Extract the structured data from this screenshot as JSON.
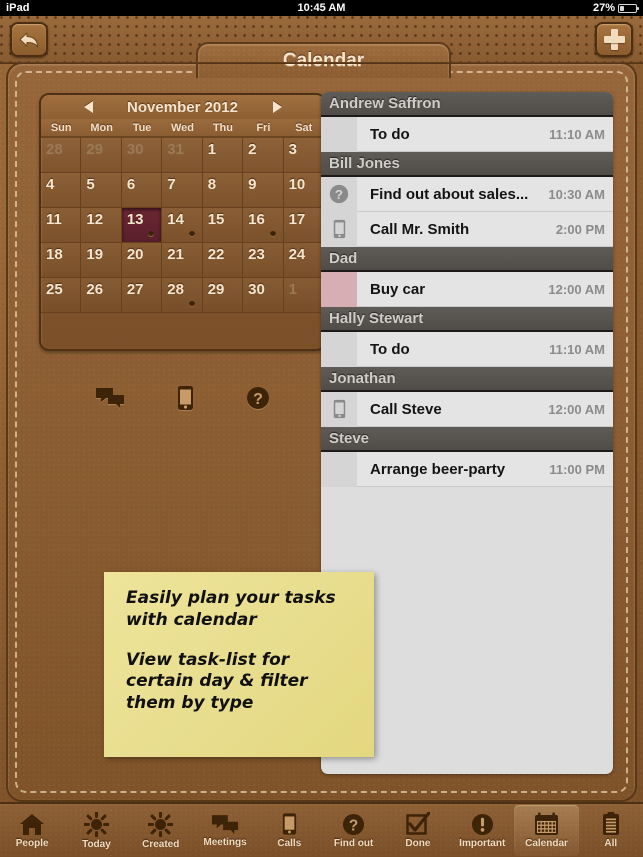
{
  "status_bar": {
    "device": "iPad",
    "time": "10:45 AM",
    "battery_percent": "27%"
  },
  "nav": {
    "title": "Calendar",
    "back_icon": "back-arrow-icon",
    "add_icon": "plus-icon"
  },
  "calendar": {
    "month_label": "November 2012",
    "prev_icon": "triangle-left-icon",
    "next_icon": "triangle-right-icon",
    "weekdays": [
      "Sun",
      "Mon",
      "Tue",
      "Wed",
      "Thu",
      "Fri",
      "Sat"
    ],
    "selected_day": 13,
    "selected_color": "#6d2633",
    "days": [
      {
        "n": "28",
        "muted": true,
        "dot": false
      },
      {
        "n": "29",
        "muted": true,
        "dot": false
      },
      {
        "n": "30",
        "muted": true,
        "dot": false
      },
      {
        "n": "31",
        "muted": true,
        "dot": false
      },
      {
        "n": "1",
        "muted": false,
        "dot": false
      },
      {
        "n": "2",
        "muted": false,
        "dot": false
      },
      {
        "n": "3",
        "muted": false,
        "dot": false
      },
      {
        "n": "4",
        "muted": false,
        "dot": false
      },
      {
        "n": "5",
        "muted": false,
        "dot": false
      },
      {
        "n": "6",
        "muted": false,
        "dot": false
      },
      {
        "n": "7",
        "muted": false,
        "dot": false
      },
      {
        "n": "8",
        "muted": false,
        "dot": false
      },
      {
        "n": "9",
        "muted": false,
        "dot": false
      },
      {
        "n": "10",
        "muted": false,
        "dot": false
      },
      {
        "n": "11",
        "muted": false,
        "dot": false
      },
      {
        "n": "12",
        "muted": false,
        "dot": false
      },
      {
        "n": "13",
        "muted": false,
        "dot": true,
        "selected": true
      },
      {
        "n": "14",
        "muted": false,
        "dot": true
      },
      {
        "n": "15",
        "muted": false,
        "dot": false
      },
      {
        "n": "16",
        "muted": false,
        "dot": true
      },
      {
        "n": "17",
        "muted": false,
        "dot": false
      },
      {
        "n": "18",
        "muted": false,
        "dot": false
      },
      {
        "n": "19",
        "muted": false,
        "dot": false
      },
      {
        "n": "20",
        "muted": false,
        "dot": false
      },
      {
        "n": "21",
        "muted": false,
        "dot": false
      },
      {
        "n": "22",
        "muted": false,
        "dot": false
      },
      {
        "n": "23",
        "muted": false,
        "dot": false
      },
      {
        "n": "24",
        "muted": false,
        "dot": false
      },
      {
        "n": "25",
        "muted": false,
        "dot": false
      },
      {
        "n": "26",
        "muted": false,
        "dot": false
      },
      {
        "n": "27",
        "muted": false,
        "dot": false
      },
      {
        "n": "28",
        "muted": false,
        "dot": true
      },
      {
        "n": "29",
        "muted": false,
        "dot": false
      },
      {
        "n": "30",
        "muted": false,
        "dot": false
      },
      {
        "n": "1",
        "muted": true,
        "dot": false
      }
    ]
  },
  "filters": [
    {
      "icon": "chat-bubbles-icon",
      "name": "meetings"
    },
    {
      "icon": "phone-icon",
      "name": "calls"
    },
    {
      "icon": "question-mark-icon",
      "name": "find-out"
    }
  ],
  "task_list": [
    {
      "contact": "Andrew Saffron",
      "tasks": [
        {
          "icon": "none",
          "title": "To do",
          "time": "11:10 AM"
        }
      ]
    },
    {
      "contact": "Bill Jones",
      "tasks": [
        {
          "icon": "question-mark-icon",
          "title": "Find out about sales...",
          "time": "10:30 AM"
        },
        {
          "icon": "phone-icon",
          "title": "Call Mr. Smith",
          "time": "2:00 PM"
        }
      ]
    },
    {
      "contact": "Dad",
      "tasks": [
        {
          "icon": "none-pink",
          "title": "Buy car",
          "time": "12:00 AM"
        }
      ]
    },
    {
      "contact": "Hally Stewart",
      "tasks": [
        {
          "icon": "none",
          "title": "To do",
          "time": "11:10 AM"
        }
      ]
    },
    {
      "contact": "Jonathan",
      "tasks": [
        {
          "icon": "phone-icon",
          "title": "Call Steve",
          "time": "12:00 AM"
        }
      ]
    },
    {
      "contact": "Steve",
      "tasks": [
        {
          "icon": "none",
          "title": "Arrange beer-party",
          "time": "11:00 PM"
        }
      ]
    }
  ],
  "sticky_note": {
    "line1": "Easily plan your tasks with calendar",
    "line2": "View task-list for certain day & filter them by type",
    "color": "#ece293"
  },
  "tabbar": {
    "active": "Calendar",
    "items": [
      {
        "label": "People",
        "icon": "home-icon"
      },
      {
        "label": "Today",
        "icon": "sun-icon"
      },
      {
        "label": "Created",
        "icon": "sun-icon"
      },
      {
        "label": "Meetings",
        "icon": "chat-bubbles-icon"
      },
      {
        "label": "Calls",
        "icon": "phone-icon"
      },
      {
        "label": "Find out",
        "icon": "question-mark-icon"
      },
      {
        "label": "Done",
        "icon": "checkbox-icon"
      },
      {
        "label": "Important",
        "icon": "exclamation-icon"
      },
      {
        "label": "Calendar",
        "icon": "calendar-icon"
      },
      {
        "label": "All",
        "icon": "clipboard-icon"
      }
    ]
  }
}
